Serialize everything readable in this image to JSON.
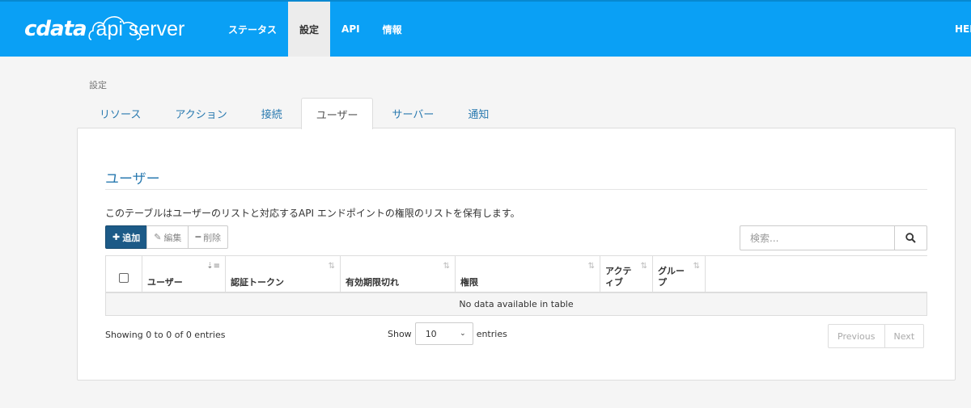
{
  "header": {
    "logo_brand": "cdata",
    "logo_product": "api server",
    "nav": [
      {
        "label": "ステータス"
      },
      {
        "label": "設定"
      },
      {
        "label": "API"
      },
      {
        "label": "情報"
      }
    ],
    "user_label": "HELP",
    "colors": {
      "bar": "#0aa0f5",
      "active_tab": "#ececec"
    }
  },
  "breadcrumb": "設定",
  "tabs": [
    {
      "label": "リソース"
    },
    {
      "label": "アクション"
    },
    {
      "label": "接続"
    },
    {
      "label": "ユーザー"
    },
    {
      "label": "サーバー"
    },
    {
      "label": "通知"
    }
  ],
  "section": {
    "title": "ユーザー",
    "description": "このテーブルはユーザーのリストと対応するAPI エンドポイントの権限のリストを保有します。"
  },
  "toolbar": {
    "add_label": "追加",
    "edit_label": "編集",
    "delete_label": "削除",
    "search_placeholder": "検索..."
  },
  "table": {
    "columns": [
      {
        "label": ""
      },
      {
        "label": "ユーザー"
      },
      {
        "label": "認証トークン"
      },
      {
        "label": "有効期限切れ"
      },
      {
        "label": "権限"
      },
      {
        "label": "アクテ\nィブ"
      },
      {
        "label": "グルー\nプ"
      }
    ],
    "empty_message": "No data available in table"
  },
  "footer": {
    "info": "Showing 0 to 0 of 0 entries",
    "show_label": "Show",
    "page_length": "10",
    "entries_label": "entries",
    "previous_label": "Previous",
    "next_label": "Next"
  }
}
